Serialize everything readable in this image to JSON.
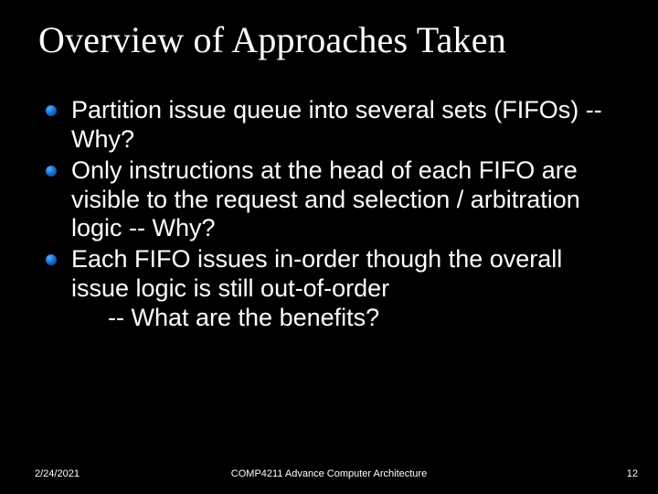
{
  "title": "Overview of Approaches Taken",
  "bullets": [
    {
      "text": "Partition issue queue into several sets (FIFOs)   -- Why?"
    },
    {
      "text": "Only instructions at the head of each FIFO are visible to the request and selection / arbitration logic   -- Why?"
    },
    {
      "text": "Each FIFO issues in-order though the overall issue logic is still out-of-order",
      "sub": "-- What are the benefits?"
    }
  ],
  "footer": {
    "date": "2/24/2021",
    "center": "COMP4211 Advance Computer Architecture",
    "page": "12"
  }
}
